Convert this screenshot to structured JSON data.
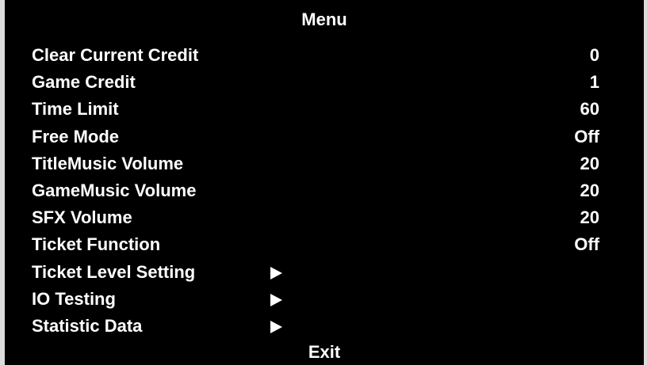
{
  "menu": {
    "title": "Menu",
    "items": [
      {
        "label": "Clear Current Credit",
        "value": "0"
      },
      {
        "label": "Game Credit",
        "value": "1"
      },
      {
        "label": "Time Limit",
        "value": "60"
      },
      {
        "label": "Free Mode",
        "value": "Off"
      },
      {
        "label": "TitleMusic Volume",
        "value": "20"
      },
      {
        "label": "GameMusic Volume",
        "value": "20"
      },
      {
        "label": "SFX Volume",
        "value": "20"
      },
      {
        "label": "Ticket Function",
        "value": "Off"
      },
      {
        "label": "Ticket Level Setting",
        "submenu_icon": "right-triangle-arrow"
      },
      {
        "label": "IO Testing",
        "submenu_icon": "right-triangle-arrow"
      },
      {
        "label": "Statistic Data",
        "submenu_icon": "right-triangle-arrow"
      }
    ],
    "exit_label": "Exit"
  },
  "colors": {
    "background": "#000000",
    "text": "#ffffff",
    "outer": "#dcdcdc"
  }
}
